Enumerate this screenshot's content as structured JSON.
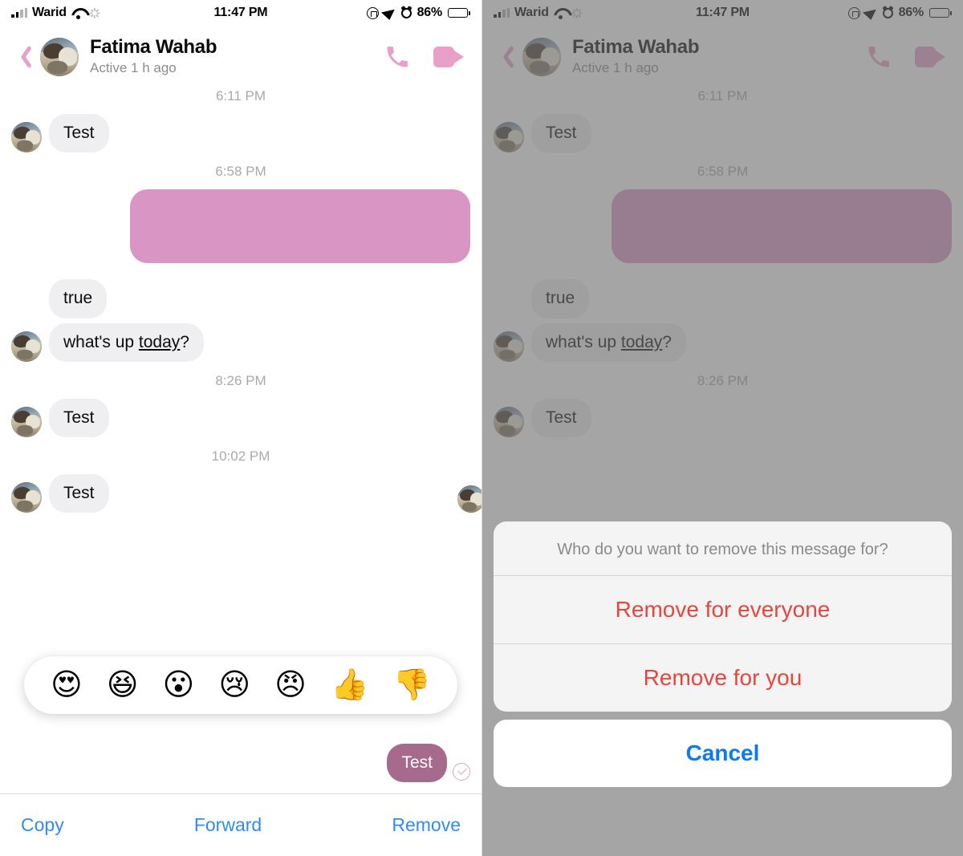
{
  "status_bar": {
    "carrier": "Warid",
    "time": "11:47 PM",
    "battery_percent": "86%",
    "icons": [
      "signal-bars-icon",
      "wifi-icon",
      "spinner-icon",
      "rotation-lock-icon",
      "location-arrow-icon",
      "alarm-icon",
      "battery-icon"
    ]
  },
  "nav": {
    "back_label": "back-chevron-icon",
    "contact_name": "Fatima Wahab",
    "active_status": "Active 1 h ago",
    "call_label": "phone-icon",
    "video_label": "video-camera-icon"
  },
  "thread": {
    "timestamps": {
      "t1": "6:11 PM",
      "t2": "6:58 PM",
      "t3": "8:26 PM",
      "t4": "10:02 PM"
    },
    "messages": {
      "m1": "Test",
      "m2_redacted": "",
      "m3": "true",
      "m4_prefix": "what's up ",
      "m4_link": "today",
      "m4_suffix": "?",
      "m5": "Test",
      "m6": "Test",
      "m7_sent": "Test"
    }
  },
  "reactions": {
    "items": [
      {
        "name": "heart-eyes-reaction",
        "glyph": "😍"
      },
      {
        "name": "laughing-reaction",
        "glyph": "😆"
      },
      {
        "name": "wow-reaction",
        "glyph": "😮"
      },
      {
        "name": "sad-reaction",
        "glyph": "😢"
      },
      {
        "name": "angry-reaction",
        "glyph": "😠"
      },
      {
        "name": "thumbs-up-reaction",
        "glyph": "👍"
      },
      {
        "name": "thumbs-down-reaction",
        "glyph": "👎"
      }
    ]
  },
  "action_bar": {
    "copy": "Copy",
    "forward": "Forward",
    "remove": "Remove"
  },
  "action_sheet": {
    "title": "Who do you want to remove this message for?",
    "remove_everyone": "Remove for everyone",
    "remove_you": "Remove for you",
    "cancel": "Cancel"
  },
  "colors": {
    "accent_pink": "#e8a0c8",
    "sent_bubble": "#a66b8c",
    "redacted_bubble": "#d995c4",
    "received_bubble": "#efeff1",
    "link_blue": "#2d8cf5",
    "destructive_red": "#e8453c",
    "dim_overlay": "#6e6e6e"
  }
}
